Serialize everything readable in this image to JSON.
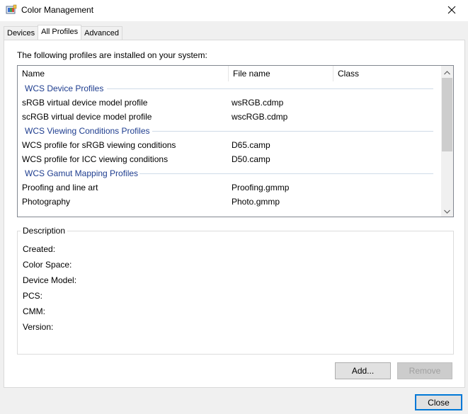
{
  "window": {
    "title": "Color Management",
    "icon": "color-management-icon",
    "close_glyph": "✕"
  },
  "tabs": [
    {
      "label": "Devices",
      "active": false
    },
    {
      "label": "All Profiles",
      "active": true
    },
    {
      "label": "Advanced",
      "active": false
    }
  ],
  "intro_text": "The following profiles are installed on your system:",
  "list": {
    "columns": [
      "Name",
      "File name",
      "Class"
    ],
    "groups": [
      {
        "title": "WCS Device Profiles",
        "rows": [
          {
            "name": "sRGB virtual device model profile",
            "file": "wsRGB.cdmp",
            "class": ""
          },
          {
            "name": "scRGB virtual device model profile",
            "file": "wscRGB.cdmp",
            "class": ""
          }
        ]
      },
      {
        "title": "WCS Viewing Conditions Profiles",
        "rows": [
          {
            "name": "WCS profile for sRGB viewing conditions",
            "file": "D65.camp",
            "class": ""
          },
          {
            "name": "WCS profile for ICC viewing conditions",
            "file": "D50.camp",
            "class": ""
          }
        ]
      },
      {
        "title": "WCS Gamut Mapping Profiles",
        "rows": [
          {
            "name": "Proofing and line art",
            "file": "Proofing.gmmp",
            "class": ""
          },
          {
            "name": "Photography",
            "file": "Photo.gmmp",
            "class": ""
          }
        ]
      }
    ]
  },
  "description": {
    "legend": "Description",
    "fields": [
      "Created:",
      "Color Space:",
      "Device Model:",
      "PCS:",
      "CMM:",
      "Version:"
    ]
  },
  "buttons": {
    "add": "Add...",
    "remove": "Remove",
    "close": "Close"
  },
  "colors": {
    "group_header": "#1e3d8f",
    "accent": "#0078d7"
  }
}
